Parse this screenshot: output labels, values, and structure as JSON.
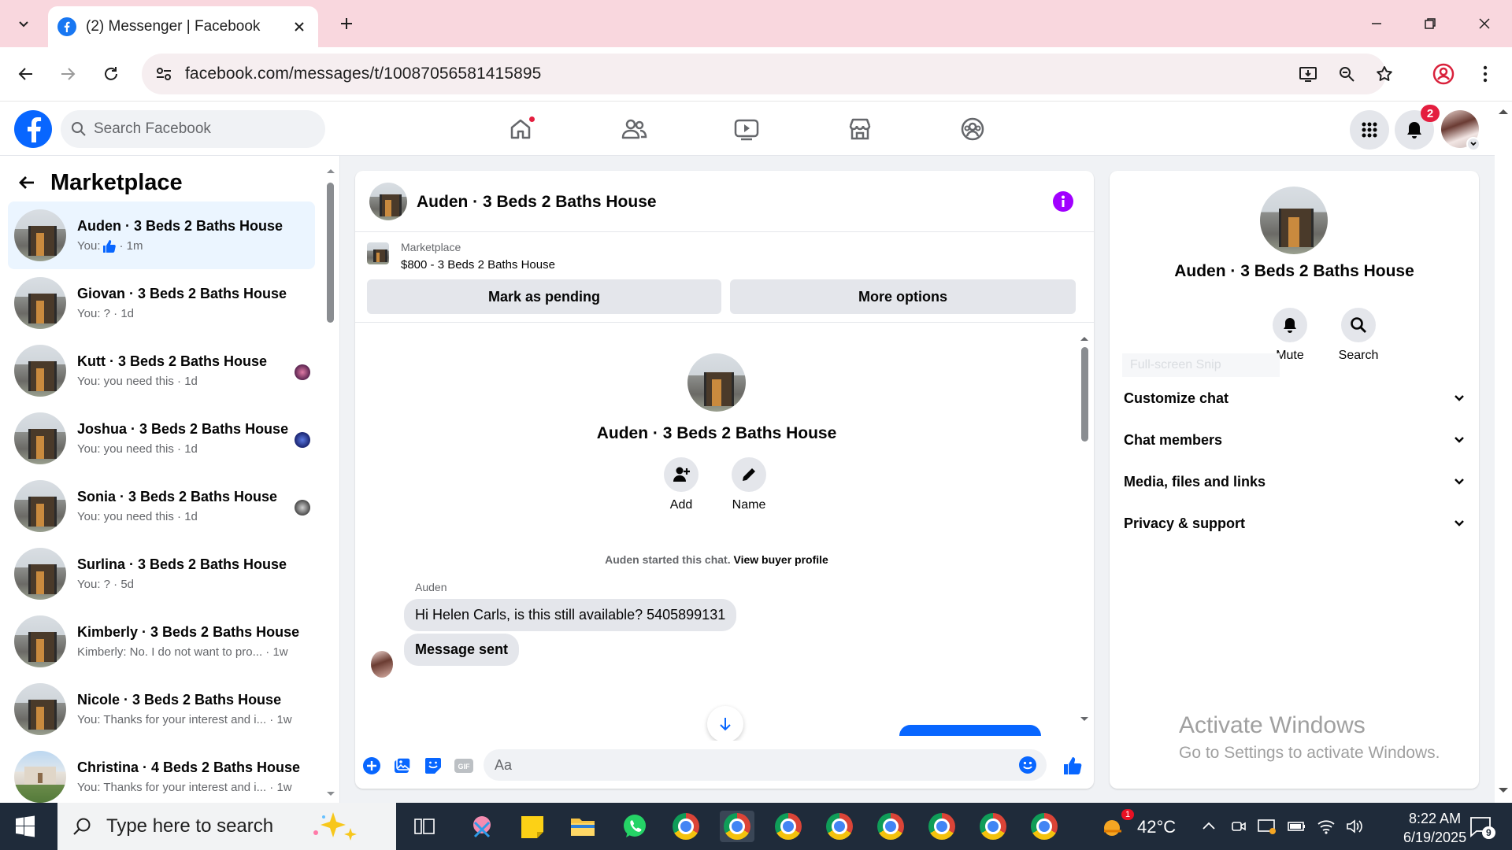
{
  "browser": {
    "tab_title": "(2) Messenger | Facebook",
    "url": "facebook.com/messages/t/10087056581415895"
  },
  "fb": {
    "search_placeholder": "Search Facebook",
    "notification_count": "2"
  },
  "sidebar": {
    "title": "Marketplace",
    "conversations": [
      {
        "name": "Auden · 3 Beds 2 Baths House",
        "snippet_prefix": "You:",
        "snippet": "· 1m",
        "thumb": true,
        "active": true
      },
      {
        "name": "Giovan · 3 Beds 2 Baths House",
        "snippet": "You: ? · 1d"
      },
      {
        "name": "Kutt · 3 Beds 2 Baths House",
        "snippet": "You: you need this · 1d",
        "seen_color": "#8a3a6a"
      },
      {
        "name": "Joshua · 3 Beds 2 Baths House",
        "snippet": "You: you need this · 1d",
        "seen_color": "#2a3aa0"
      },
      {
        "name": "Sonia · 3 Beds 2 Baths House",
        "snippet": "You: you need this · 1d",
        "seen_color": "#7a7a7a"
      },
      {
        "name": "Surlina · 3 Beds 2 Baths House",
        "snippet": "You: ? · 5d"
      },
      {
        "name": "Kimberly · 3 Beds 2 Baths House",
        "snippet": "Kimberly: No. I do not want to pro... · 1w"
      },
      {
        "name": "Nicole · 3 Beds 2 Baths House",
        "snippet": "You: Thanks for your interest and i... · 1w"
      },
      {
        "name": "Christina · 4 Beds 2 Baths House",
        "snippet": "You: Thanks for your interest and i... · 1w"
      }
    ]
  },
  "chat": {
    "title": "Auden · 3 Beds 2 Baths House",
    "marketplace_label": "Marketplace",
    "listing": "$800 - 3 Beds 2 Baths House",
    "mark_pending": "Mark as pending",
    "more_options": "More options",
    "profile_name": "Auden · 3 Beds 2 Baths House",
    "add_label": "Add",
    "name_label": "Name",
    "started_text": "Auden started this chat.",
    "view_buyer": "View buyer profile",
    "sender": "Auden",
    "messages": [
      "Hi Helen Carls, is this still available? 5405899131",
      "Message sent"
    ],
    "composer_placeholder": "Aa"
  },
  "details": {
    "name": "Auden · 3 Beds 2 Baths House",
    "mute": "Mute",
    "search": "Search",
    "ghost_text": "Full-screen Snip",
    "sections": [
      "Customize chat",
      "Chat members",
      "Media, files and links",
      "Privacy & support"
    ]
  },
  "watermark": {
    "line1": "Activate Windows",
    "line2": "Go to Settings to activate Windows."
  },
  "taskbar": {
    "search_placeholder": "Type here to search",
    "weather_badge": "1",
    "temperature": "42°C",
    "time": "8:22 AM",
    "date": "6/19/2025",
    "notification_count": "9"
  }
}
